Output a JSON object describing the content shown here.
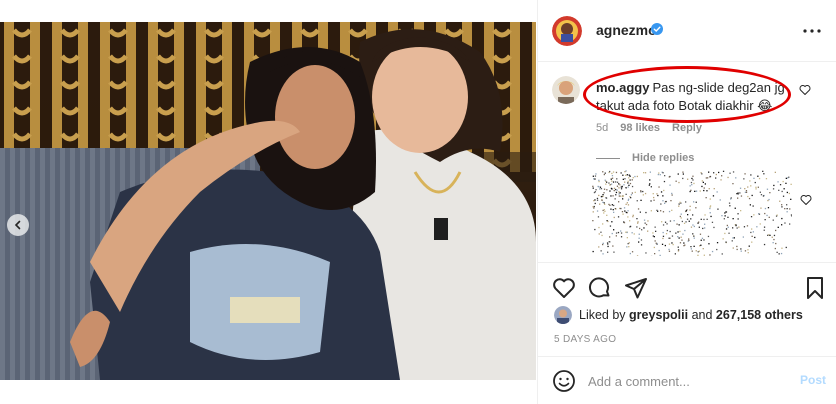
{
  "post": {
    "author": "agnezmo",
    "verified": true
  },
  "comment": {
    "username": "mo.aggy",
    "text": "Pas ng-slide deg2an jg takut ada foto Botak diakhir 😂",
    "age": "5d",
    "likes": "98 likes",
    "reply_label": "Reply",
    "hide_replies_label": "Hide replies"
  },
  "likes": {
    "prefix": "Liked by",
    "user": "greyspolii",
    "conj": "and",
    "others": "267,158 others"
  },
  "date": "5 DAYS AGO",
  "composer": {
    "placeholder": "Add a comment...",
    "post_label": "Post"
  },
  "icons": {
    "verified": "verified-badge-icon",
    "more": "more-horizontal-icon",
    "heart": "heart-icon",
    "comment": "comment-icon",
    "share": "paper-plane-icon",
    "save": "bookmark-icon",
    "emoji": "emoji-icon",
    "carousel_prev": "chevron-left-icon"
  },
  "colors": {
    "accent": "#0095f6",
    "highlight_oval": "#e00000",
    "muted": "#8e8e8e",
    "post_disabled": "#b3dbff"
  }
}
